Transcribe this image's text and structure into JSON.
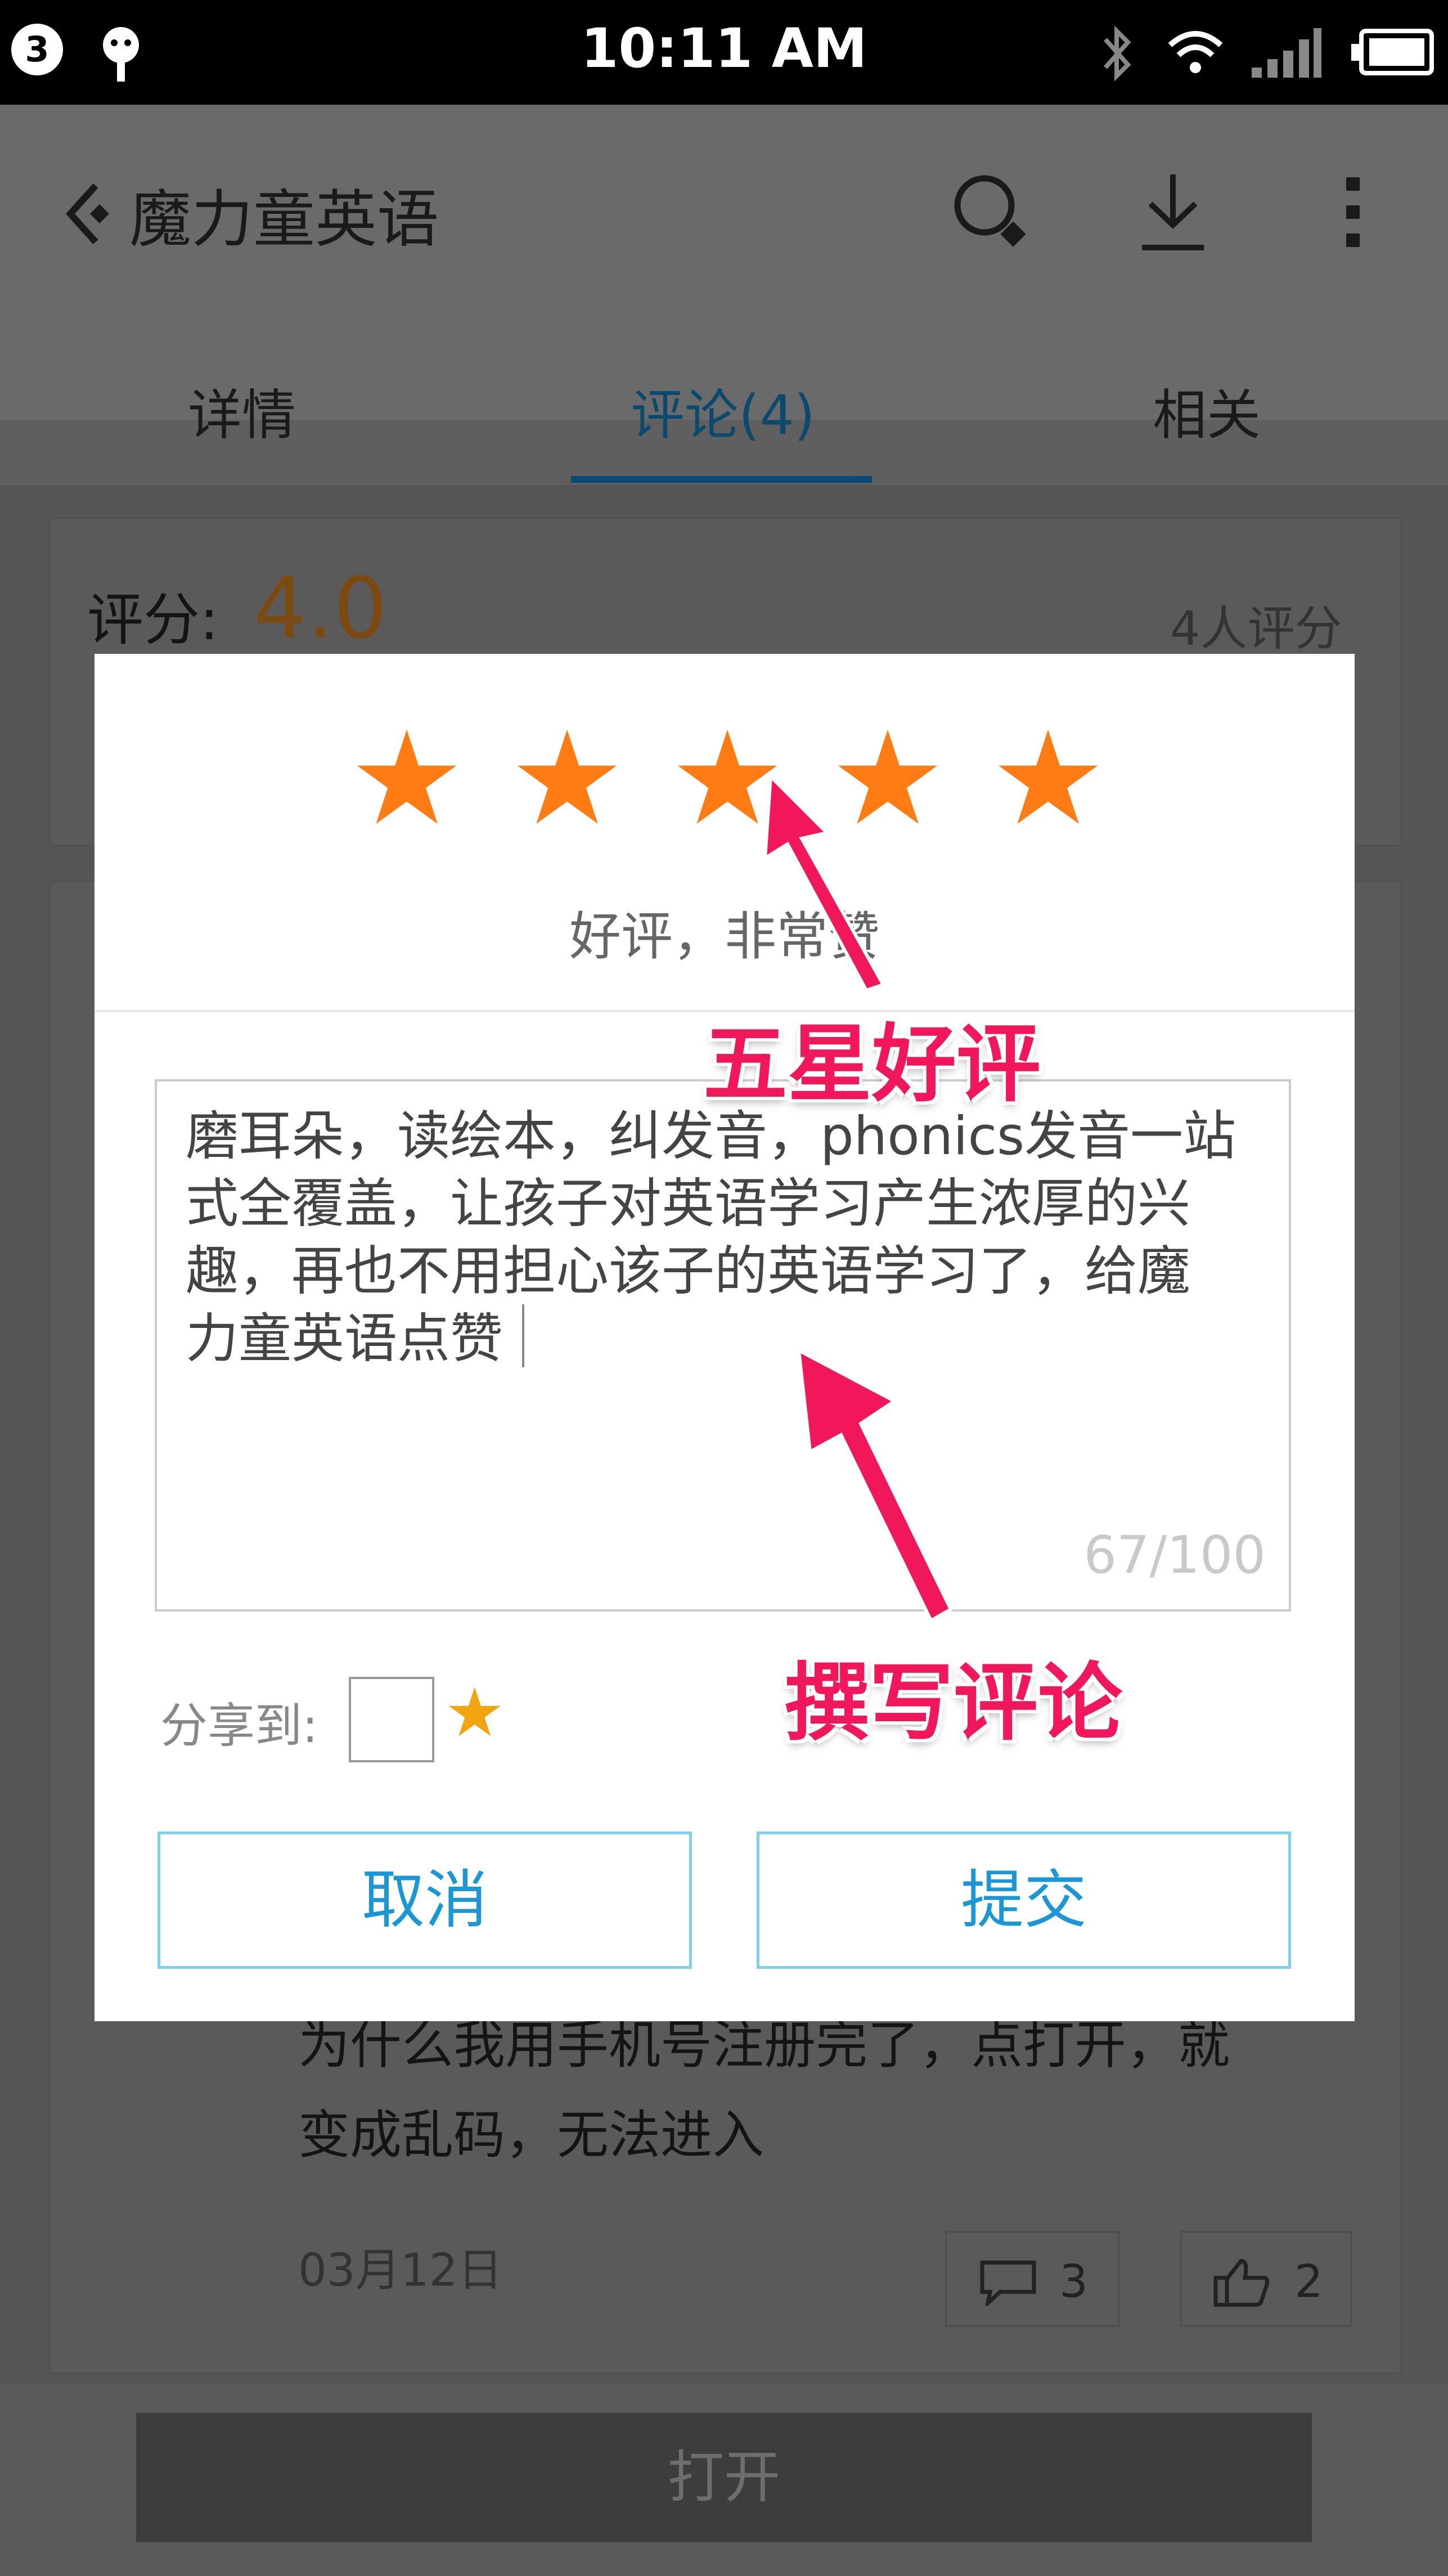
{
  "status_bar": {
    "time": "10:11 AM",
    "notification_count": "3"
  },
  "app_bar": {
    "title": "魔力童英语"
  },
  "tabs": [
    {
      "label": "详情"
    },
    {
      "label": "评论(4)"
    },
    {
      "label": "相关"
    }
  ],
  "rating_summary": {
    "label": "评分:",
    "score": "4.0",
    "count": "4人评分"
  },
  "background_comment": {
    "text_line1": "为什么我用手机号注册完了，点打开，就",
    "text_line2": "变成乱码，无法进入",
    "date": "03月12日",
    "reply_count": "3",
    "like_count": "2"
  },
  "dialog": {
    "stars_selected": 5,
    "stars_total": 5,
    "rating_description": "好评，非常赞",
    "comment_text": "磨耳朵，读绘本，纠发音，phonics发音一站\n式全覆盖，让孩子对英语学习产生浓厚的兴\n趣，再也不用担心该子的英语学习了，给魔\n力童英语点赞",
    "char_counter": "67/100",
    "share_label": "分享到:",
    "cancel_label": "取消",
    "submit_label": "提交"
  },
  "annotations": {
    "five_star": "五星好评",
    "write_review": "撰写评论"
  },
  "bottom": {
    "open_label": "打开"
  },
  "colors": {
    "accent": "#1b97d6",
    "star": "#ff7b14",
    "annotation": "#f0185a",
    "score": "#e8861b"
  }
}
